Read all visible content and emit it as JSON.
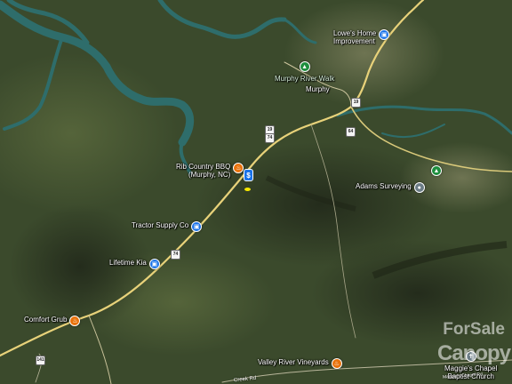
{
  "map": {
    "water_color": "#2d6b6a",
    "road_color": "#e8d27a",
    "land_color": "#3c4a2c"
  },
  "pois": [
    {
      "id": "lowes",
      "label_lines": [
        "Lowe's Home",
        "Improvement"
      ],
      "icon": "shopping-bag-icon",
      "color": "#1a73e8",
      "glyph": "▣"
    },
    {
      "id": "river-walk",
      "label_lines": [
        "Murphy River Walk"
      ],
      "icon": "park-icon",
      "color": "#1e8e3e",
      "glyph": "▲"
    },
    {
      "id": "rib-country",
      "label_lines": [
        "Rib Country BBQ",
        "(Murphy, NC)"
      ],
      "icon": "restaurant-icon",
      "color": "#e8710a",
      "glyph": "♨"
    },
    {
      "id": "adams",
      "label_lines": [
        "Adams Surveying"
      ],
      "icon": "place-icon",
      "color": "#6b7c86",
      "glyph": "●"
    },
    {
      "id": "east-park",
      "label_lines": [],
      "icon": "park-icon",
      "color": "#1e8e3e",
      "glyph": "▲"
    },
    {
      "id": "tractor",
      "label_lines": [
        "Tractor Supply Co"
      ],
      "icon": "shopping-cart-icon",
      "color": "#1a73e8",
      "glyph": "▣"
    },
    {
      "id": "lifetime-kia",
      "label_lines": [
        "Lifetime Kia"
      ],
      "icon": "car-dealer-icon",
      "color": "#1a73e8",
      "glyph": "▣"
    },
    {
      "id": "comfort-grub",
      "label_lines": [
        "Comfort Grub"
      ],
      "icon": "restaurant-icon",
      "color": "#e8710a",
      "glyph": "♨"
    },
    {
      "id": "valley-river",
      "label_lines": [
        "Valley River Vineyards"
      ],
      "icon": "winery-icon",
      "color": "#e8710a",
      "glyph": "♨"
    },
    {
      "id": "maggies",
      "label_lines": [
        "Maggie's Chapel",
        "Baptist Church"
      ],
      "icon": "church-icon",
      "color": "#6b7c86",
      "glyph": "✝"
    }
  ],
  "town_label": "Murphy",
  "highway_shields": {
    "h1": "19",
    "h2": "19",
    "h3": "64",
    "h4": "74",
    "h5": "74",
    "h6": "141"
  },
  "road_labels": {
    "creek_rd": "Creek Rd",
    "chapel_rd": "Maggie's Chapel Rd"
  },
  "listing_marker": {
    "glyph": "$"
  },
  "watermark": {
    "line1": "ForSale",
    "line2": "Canopy"
  }
}
